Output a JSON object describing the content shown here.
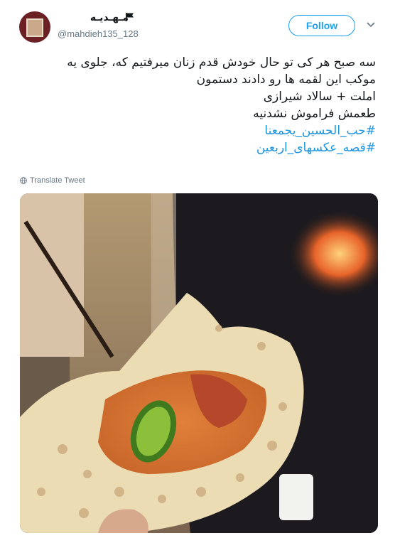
{
  "user": {
    "display_name": "مـهـديـه",
    "handle": "@mahdieh135_128"
  },
  "follow_label": "Follow",
  "tweet": {
    "lines": [
      "سه صبح هر کی تو حال خودش قدم زنان میرفتیم که، جلوی یه",
      "موکب این لقمه ها رو دادند دستمون",
      "املت + سالاد شیرازی",
      "طعمش فراموش نشدنیه"
    ],
    "hashtags": [
      "#حب_الحسین_یجمعنا",
      "#قصه_عکسهای_اربعین"
    ]
  },
  "translate_label": "Translate Tweet",
  "colors": {
    "accent": "#1da1f2",
    "hashtag": "#1b95e0",
    "muted": "#657786"
  }
}
